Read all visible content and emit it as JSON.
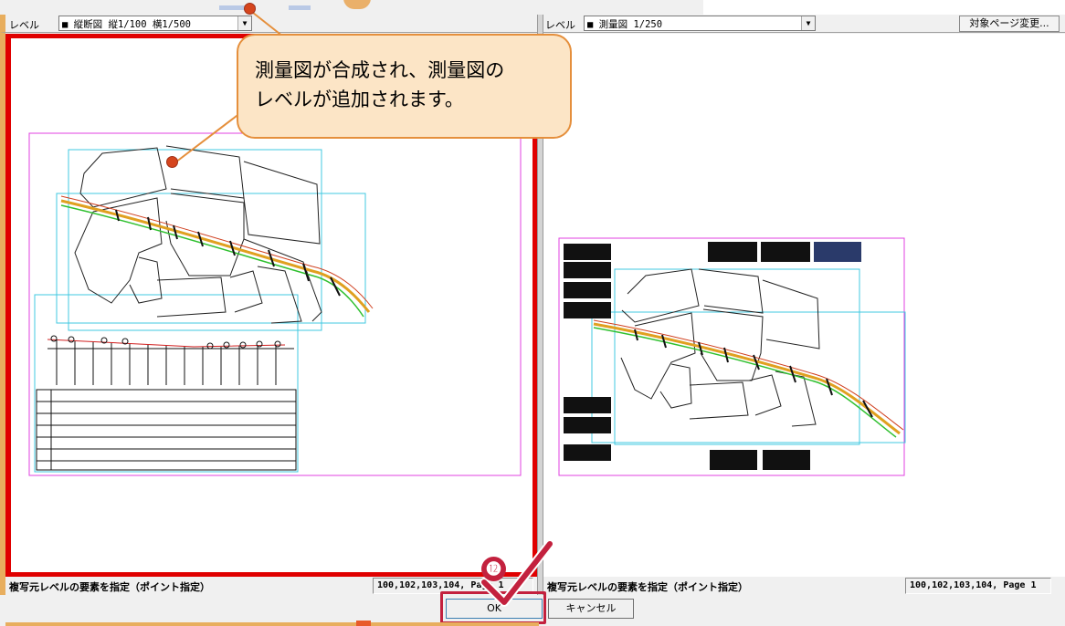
{
  "left_pane": {
    "level_label": "レベル",
    "level_value": "■ 縦断図 縦1/100 横1/500",
    "status_message": "複写元レベルの要素を指定（ポイント指定）",
    "status_coords": "100,102,103,104, Page 1"
  },
  "right_pane": {
    "level_label": "レベル",
    "level_value": "■ 測量図 1/250",
    "target_page_button": "対象ページ変更...",
    "status_message": "複写元レベルの要素を指定（ポイント指定）",
    "status_coords": "100,102,103,104, Page 1"
  },
  "buttons": {
    "ok": "OK",
    "cancel": "キャンセル"
  },
  "callout": {
    "line1": "測量図が合成され、測量図の",
    "line2": "レベルが追加されます。"
  },
  "step_badge": "⓬",
  "colors": {
    "accent_red": "#c3213e",
    "callout_fill": "#fce5c6",
    "callout_border": "#e58f3c",
    "frame_magenta": "#e040e0",
    "frame_cyan": "#40c8e0"
  },
  "icons": {
    "dropdown": "chevron-down-icon",
    "checkmark": "checkmark-icon",
    "pin": "pin-dot-icon"
  }
}
